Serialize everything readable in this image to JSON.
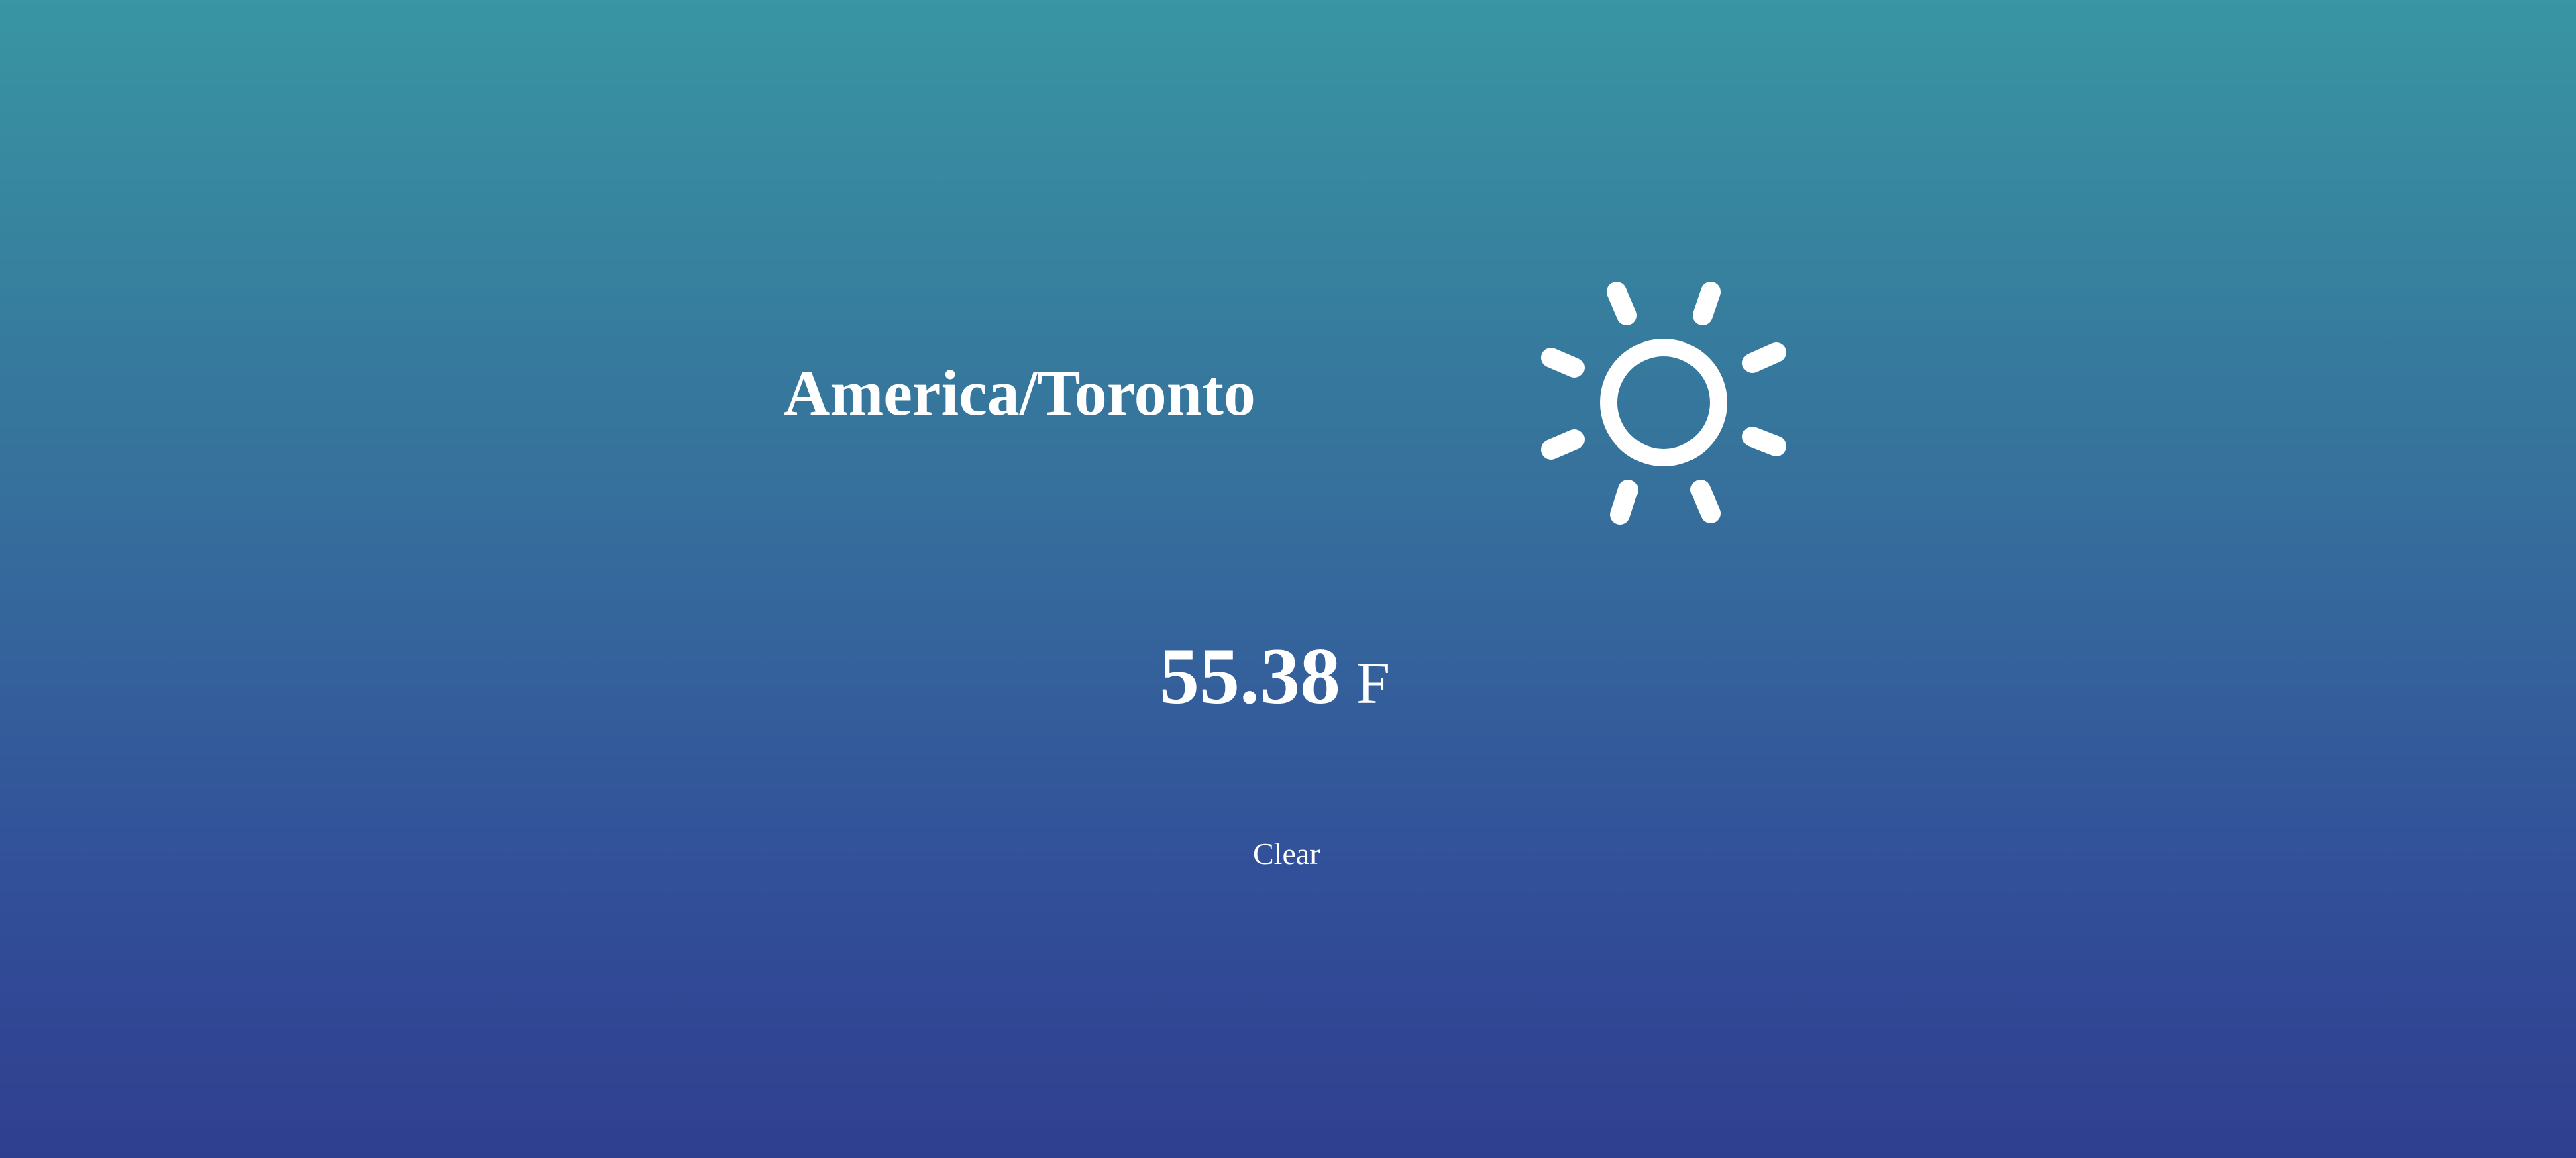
{
  "location": {
    "timezone": "America/Toronto"
  },
  "weather": {
    "icon": "clear-day-sun-icon",
    "temperature": {
      "value": "55.38",
      "unit": "F"
    },
    "summary": "Clear"
  },
  "colors": {
    "background_top": "#3895a2",
    "background_bottom": "#2f3f8f",
    "foreground": "#ffffff"
  }
}
